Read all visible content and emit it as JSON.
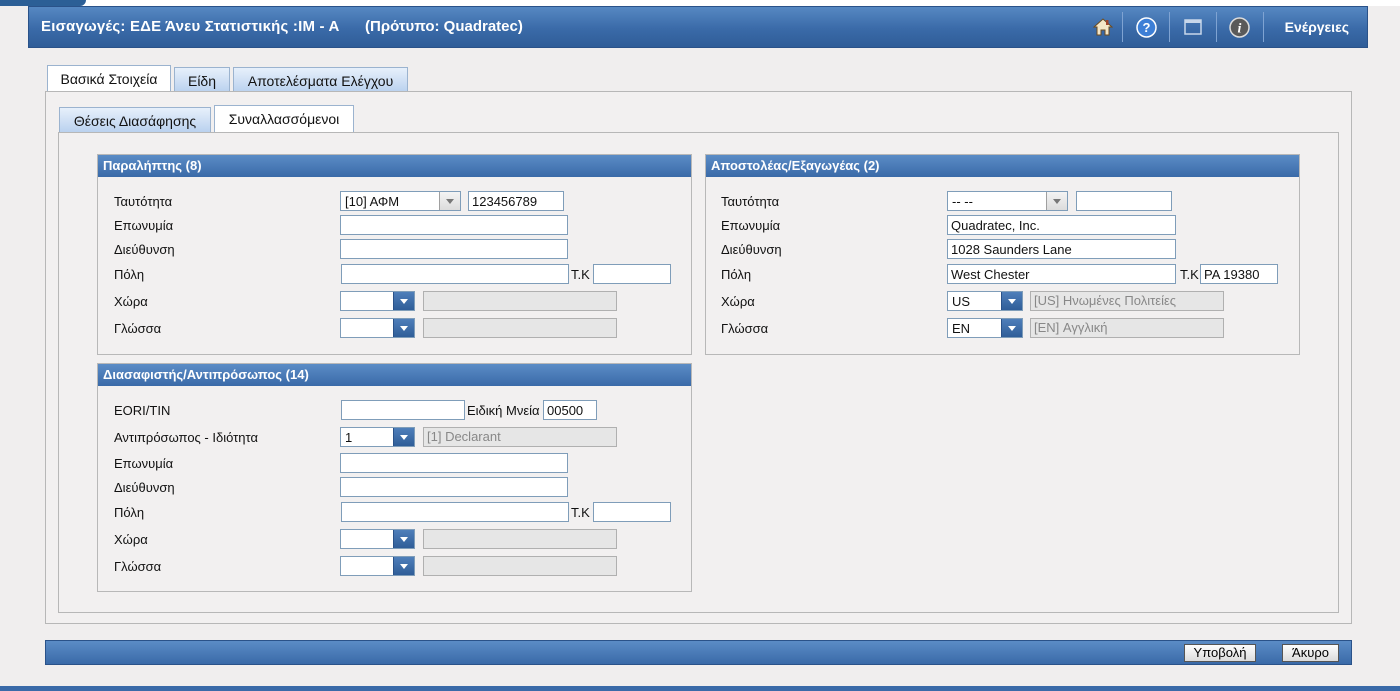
{
  "header": {
    "title": "Εισαγωγές: ΕΔΕ Άνευ Στατιστικής :IM - A",
    "template": "(Πρότυπο: Quadratec)",
    "actions_label": "Ενέργειες",
    "icons": [
      "home-icon",
      "help-icon",
      "window-icon",
      "info-icon"
    ]
  },
  "tabs": [
    {
      "label": "Βασικά Στοιχεία",
      "active": true
    },
    {
      "label": "Είδη",
      "active": false
    },
    {
      "label": "Αποτελέσματα Ελέγχου",
      "active": false
    }
  ],
  "subtabs": [
    {
      "label": "Θέσεις Διασάφησης",
      "active": false
    },
    {
      "label": "Συναλλασσόμενοι",
      "active": true
    }
  ],
  "consignee": {
    "heading": "Παραλήπτης (8)",
    "id_label": "Ταυτότητα",
    "id_type": "[10] ΑΦΜ",
    "id_value": "123456789",
    "name_label": "Επωνυμία",
    "name_value": "",
    "address_label": "Διεύθυνση",
    "address_value": "",
    "city_label": "Πόλη",
    "city_value": "",
    "postcode_label": "Τ.Κ",
    "postcode_value": "",
    "country_label": "Χώρα",
    "country_code": "",
    "country_desc": "",
    "language_label": "Γλώσσα",
    "language_code": "",
    "language_desc": ""
  },
  "consignor": {
    "heading": "Αποστολέας/Εξαγωγέας (2)",
    "id_label": "Ταυτότητα",
    "id_type": "-- --",
    "id_value": "",
    "name_label": "Επωνυμία",
    "name_value": "Quadratec, Inc.",
    "address_label": "Διεύθυνση",
    "address_value": "1028 Saunders Lane",
    "city_label": "Πόλη",
    "city_value": "West Chester",
    "postcode_label": "Τ.Κ",
    "postcode_value": "PA 19380",
    "country_label": "Χώρα",
    "country_code": "US",
    "country_desc": "[US] Ηνωμένες Πολιτείες",
    "language_label": "Γλώσσα",
    "language_code": "EN",
    "language_desc": "[EN] Αγγλική"
  },
  "declarant": {
    "heading": "Διασαφιστής/Αντιπρόσωπος (14)",
    "eori_label": "EORI/TIN",
    "eori_value": "",
    "special_label": "Ειδική Μνεία",
    "special_value": "00500",
    "rep_label": "Αντιπρόσωπος - Ιδιότητα",
    "rep_code": "1",
    "rep_desc": "[1] Declarant",
    "name_label": "Επωνυμία",
    "name_value": "",
    "address_label": "Διεύθυνση",
    "address_value": "",
    "city_label": "Πόλη",
    "city_value": "",
    "postcode_label": "Τ.Κ",
    "postcode_value": "",
    "country_label": "Χώρα",
    "country_code": "",
    "country_desc": "",
    "language_label": "Γλώσσα",
    "language_code": "",
    "language_desc": ""
  },
  "footer": {
    "submit_label": "Υποβολή",
    "cancel_label": "Άκυρο"
  }
}
